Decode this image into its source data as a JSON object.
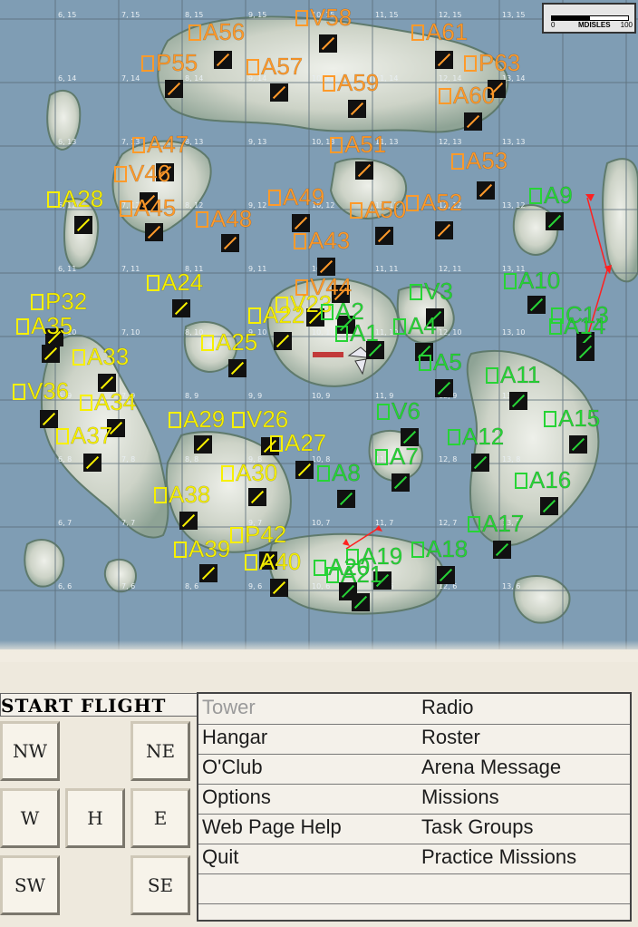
{
  "scale": {
    "start": "0",
    "label": "MDISLES",
    "end": "100"
  },
  "grid_labels": [
    {
      "t": "6, 15"
    },
    {
      "t": "7, 15"
    },
    {
      "t": "8, 15"
    },
    {
      "t": "9, 15"
    },
    {
      "t": "10, 15"
    },
    {
      "t": "11, 15"
    },
    {
      "t": "12, 15"
    },
    {
      "t": "13, 15"
    },
    {
      "t": "6, 14"
    },
    {
      "t": "7, 14"
    },
    {
      "t": "8, 14"
    },
    {
      "t": "9, 14"
    },
    {
      "t": "10, 14"
    },
    {
      "t": "11, 14"
    },
    {
      "t": "12, 14"
    },
    {
      "t": "13, 14"
    },
    {
      "t": "6, 13"
    },
    {
      "t": "7, 13"
    },
    {
      "t": "8, 13"
    },
    {
      "t": "9, 13"
    },
    {
      "t": "10, 13"
    },
    {
      "t": "11, 13"
    },
    {
      "t": "12, 13"
    },
    {
      "t": "13, 13"
    },
    {
      "t": "6, 12"
    },
    {
      "t": "7, 12"
    },
    {
      "t": "8, 12"
    },
    {
      "t": "9, 12"
    },
    {
      "t": "10, 12"
    },
    {
      "t": "11, 12"
    },
    {
      "t": "12, 12"
    },
    {
      "t": "13, 12"
    },
    {
      "t": "6, 11"
    },
    {
      "t": "7, 11"
    },
    {
      "t": "8, 11"
    },
    {
      "t": "9, 11"
    },
    {
      "t": "10, 11"
    },
    {
      "t": "11, 11"
    },
    {
      "t": "12, 11"
    },
    {
      "t": "13, 11"
    },
    {
      "t": "6, 10"
    },
    {
      "t": "7, 10"
    },
    {
      "t": "8, 10"
    },
    {
      "t": "9, 10"
    },
    {
      "t": "10, 10"
    },
    {
      "t": "11, 10"
    },
    {
      "t": "12, 10"
    },
    {
      "t": "13, 10"
    },
    {
      "t": "6, 9"
    },
    {
      "t": "7, 9"
    },
    {
      "t": "8, 9"
    },
    {
      "t": "9, 9"
    },
    {
      "t": "10, 9"
    },
    {
      "t": "11, 9"
    },
    {
      "t": "12, 9"
    },
    {
      "t": "13, 9"
    },
    {
      "t": "6, 8"
    },
    {
      "t": "7, 8"
    },
    {
      "t": "8, 8"
    },
    {
      "t": "9, 8"
    },
    {
      "t": "10, 8"
    },
    {
      "t": "11, 8"
    },
    {
      "t": "12, 8"
    },
    {
      "t": "13, 8"
    },
    {
      "t": "6, 7"
    },
    {
      "t": "7, 7"
    },
    {
      "t": "8, 7"
    },
    {
      "t": "9, 7"
    },
    {
      "t": "10, 7"
    },
    {
      "t": "11, 7"
    },
    {
      "t": "12, 7"
    },
    {
      "t": "13, 7"
    },
    {
      "t": "6, 6"
    },
    {
      "t": "7, 6"
    },
    {
      "t": "8, 6"
    },
    {
      "t": "9, 6"
    },
    {
      "t": "10, 6"
    },
    {
      "t": "11, 6"
    },
    {
      "t": "12, 6"
    },
    {
      "t": "13, 6"
    }
  ],
  "colors": {
    "orange": "#ff9a2a",
    "yellow": "#f7f000",
    "green": "#27d436",
    "water": "#7f9db4",
    "land": "#d8ddd2"
  },
  "bases_orange": [
    "V58",
    "A56",
    "A61",
    "P55",
    "A57",
    "P63",
    "A59",
    "A60",
    "A47",
    "A51",
    "A53",
    "V46",
    "A45",
    "A49",
    "A52",
    "A48",
    "A50",
    "A43",
    "V44"
  ],
  "bases_yellow": [
    "A28",
    "A24",
    "P32",
    "A35",
    "V23",
    "A22",
    "A25",
    "A33",
    "V36",
    "A34",
    "A29",
    "V26",
    "A37",
    "A27",
    "A30",
    "A38",
    "A39",
    "P42",
    "A40"
  ],
  "bases_green": [
    "A9",
    "A2",
    "V3",
    "A10",
    "C13",
    "A14",
    "A1",
    "A4",
    "A5",
    "A11",
    "V6",
    "A15",
    "A12",
    "A7",
    "A8",
    "A16",
    "A17",
    "A18",
    "A19",
    "A20",
    "A21"
  ],
  "menu": {
    "start_flight": "START FLIGHT",
    "dirs": [
      "NW",
      "NE",
      "W",
      "H",
      "E",
      "SW",
      "SE"
    ],
    "left": [
      "Tower",
      "Hangar",
      "O'Club",
      "Options",
      "Web Page Help",
      "Quit",
      ""
    ],
    "right": [
      "Radio",
      "Roster",
      "Arena Message",
      "Missions",
      "Task Groups",
      "Practice Missions",
      ""
    ]
  }
}
